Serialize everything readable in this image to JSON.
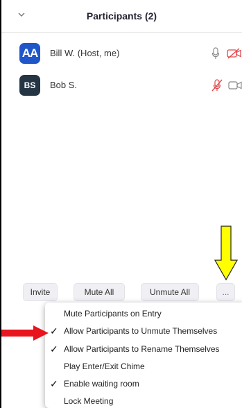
{
  "header": {
    "title": "Participants (2)"
  },
  "participants": [
    {
      "initials": "AA",
      "name": "Bill W. (Host, me)",
      "mic": "microphone-icon",
      "video": "video-off-icon"
    },
    {
      "initials": "BS",
      "name": "Bob S.",
      "mic": "microphone-muted-icon",
      "video": "video-icon"
    }
  ],
  "footer": {
    "invite_label": "Invite",
    "mute_all_label": "Mute All",
    "unmute_all_label": "Unmute All",
    "more_label": "..."
  },
  "menu": {
    "items": [
      {
        "label": "Mute Participants on Entry",
        "checked": false
      },
      {
        "label": "Allow Participants to Unmute Themselves",
        "checked": true
      },
      {
        "label": "Allow Participants to Rename Themselves",
        "checked": true
      },
      {
        "label": "Play Enter/Exit Chime",
        "checked": false
      },
      {
        "label": "Enable waiting room",
        "checked": true
      },
      {
        "label": "Lock Meeting",
        "checked": false
      }
    ],
    "check_glyph": "✓"
  },
  "annotations": {
    "yellow_arrow_color": "#ffff00",
    "red_arrow_color": "#e8141e"
  },
  "colors": {
    "host_avatar": "#1f56c9",
    "participant_avatar": "#253543",
    "muted_red": "#e0464b"
  }
}
